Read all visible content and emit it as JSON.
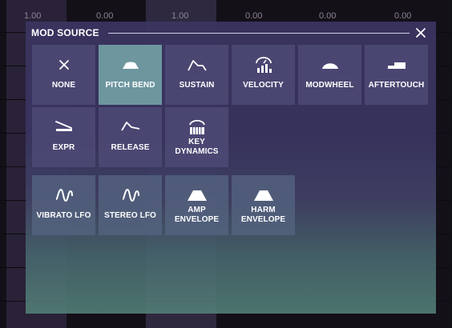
{
  "background": {
    "values": [
      "1.00",
      "0.00",
      "1.00",
      "0.00",
      "0.00",
      "0.00"
    ]
  },
  "modal": {
    "title": "MOD SOURCE",
    "close_icon": "close-icon"
  },
  "sources": [
    {
      "label": "NONE",
      "icon": "x-icon",
      "selected": false
    },
    {
      "label": "PITCH BEND",
      "icon": "pitch-bend-icon",
      "selected": true
    },
    {
      "label": "SUSTAIN",
      "icon": "sustain-icon",
      "selected": false
    },
    {
      "label": "VELOCITY",
      "icon": "velocity-icon",
      "selected": false
    },
    {
      "label": "MODWHEEL",
      "icon": "modwheel-icon",
      "selected": false
    },
    {
      "label": "AFTERTOUCH",
      "icon": "aftertouch-icon",
      "selected": false
    },
    {
      "label": "EXPR",
      "icon": "expr-icon",
      "selected": false
    },
    {
      "label": "RELEASE",
      "icon": "release-icon",
      "selected": false
    },
    {
      "label": "KEY DYNAMICS",
      "icon": "key-dynamics-icon",
      "selected": false
    },
    {
      "label": "VIBRATO LFO",
      "icon": "lfo-wave-icon",
      "selected": false
    },
    {
      "label": "STEREO LFO",
      "icon": "lfo-wave-icon",
      "selected": false
    },
    {
      "label": "AMP ENVELOPE",
      "icon": "envelope-icon",
      "selected": false
    },
    {
      "label": "HARM ENVELOPE",
      "icon": "envelope-icon",
      "selected": false
    }
  ]
}
